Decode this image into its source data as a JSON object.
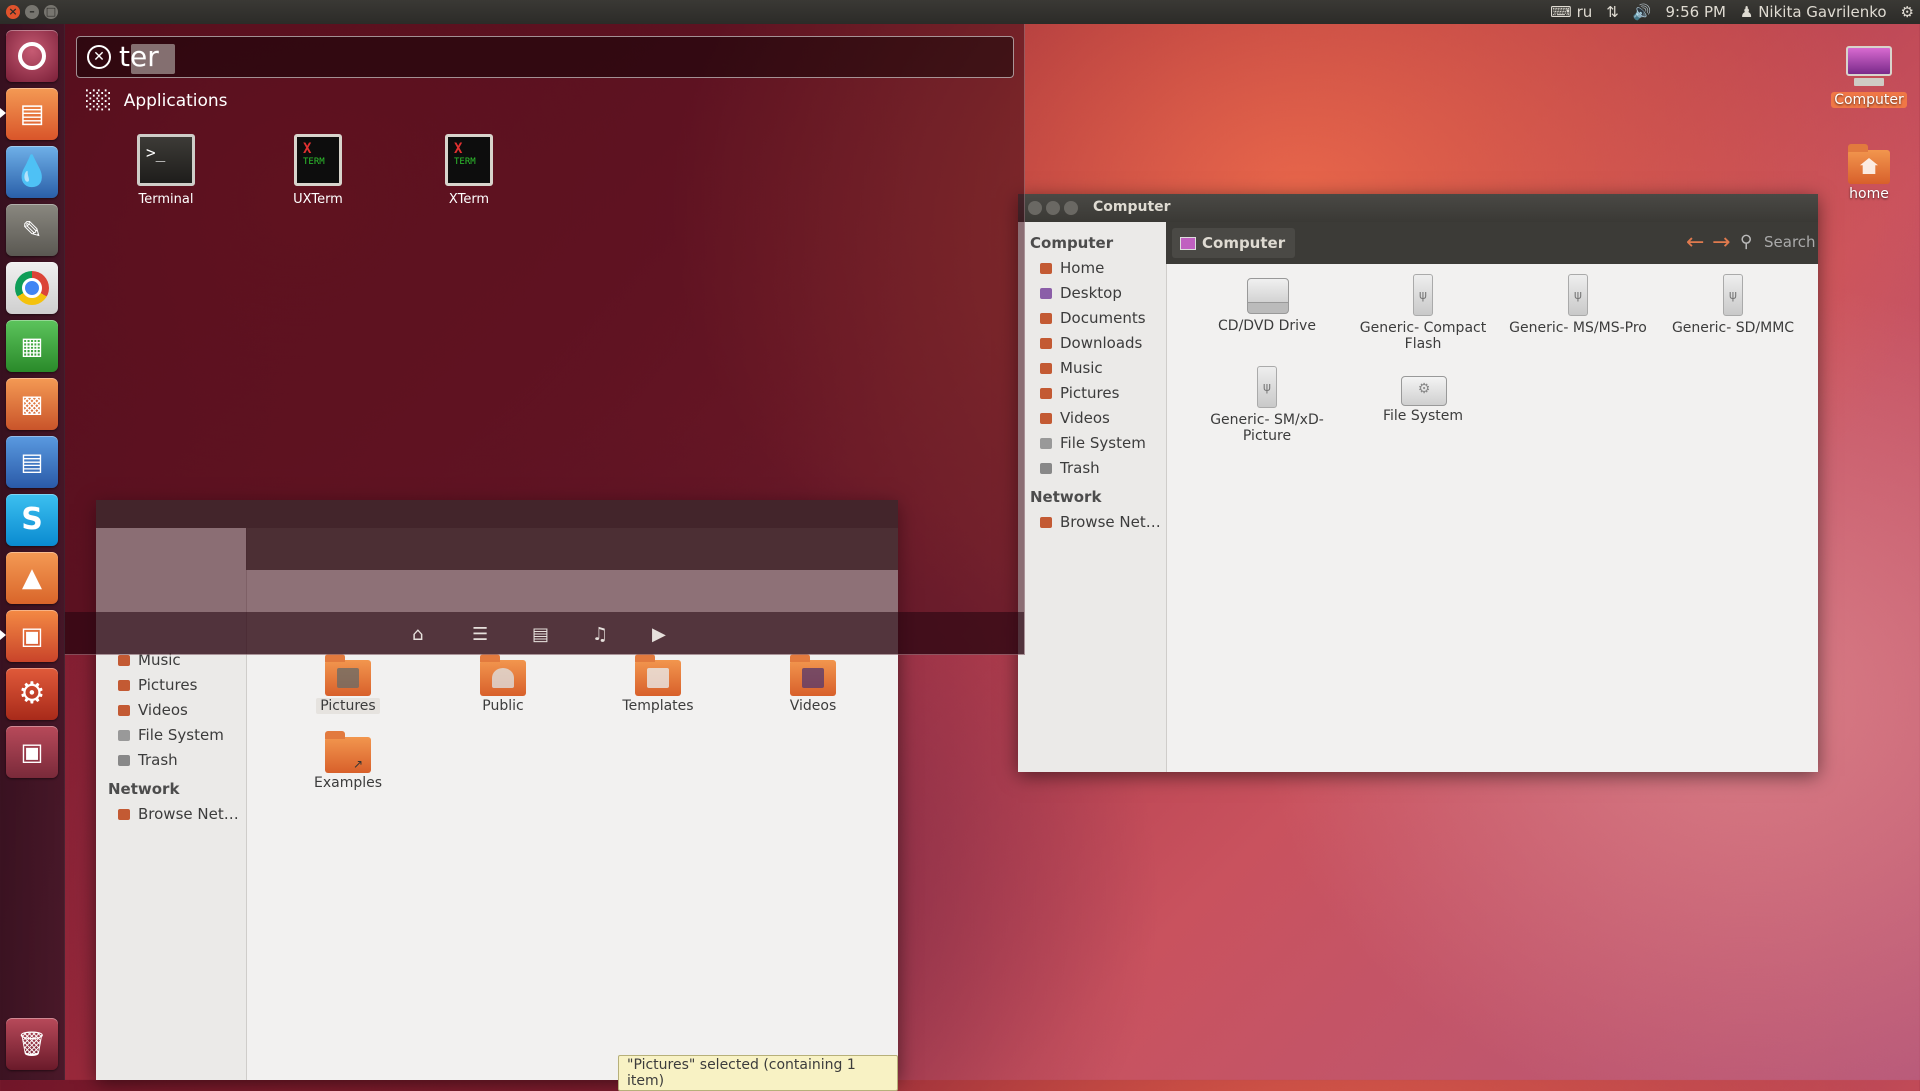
{
  "top_panel": {
    "keyboard_layout": "ru",
    "time": "9:56 PM",
    "user_name": "Nikita Gavrilenko",
    "icons": [
      "keyboard-icon",
      "network-icon",
      "volume-icon",
      "user-icon",
      "gear-icon"
    ]
  },
  "launcher": {
    "items": [
      {
        "name": "dash-home",
        "icon": "ubuntu-logo-icon"
      },
      {
        "name": "files",
        "icon": "folder-icon"
      },
      {
        "name": "drop",
        "icon": "water-drop-icon"
      },
      {
        "name": "gimp",
        "icon": "gimp-icon"
      },
      {
        "name": "chrome",
        "icon": "chrome-icon"
      },
      {
        "name": "calc",
        "icon": "spreadsheet-icon"
      },
      {
        "name": "impress",
        "icon": "presentation-icon"
      },
      {
        "name": "writer",
        "icon": "document-icon"
      },
      {
        "name": "skype",
        "icon": "skype-icon"
      },
      {
        "name": "vlc",
        "icon": "vlc-icon"
      },
      {
        "name": "software-center",
        "icon": "shopping-bag-icon"
      },
      {
        "name": "settings",
        "icon": "settings-icon"
      },
      {
        "name": "workspaces",
        "icon": "workspace-icon"
      },
      {
        "name": "trash",
        "icon": "trash-icon"
      }
    ]
  },
  "dash": {
    "search_query": "ter",
    "category": "Applications",
    "results": [
      {
        "label": "Terminal",
        "icon": "terminal-icon"
      },
      {
        "label": "UXTerm",
        "icon": "xterm-icon"
      },
      {
        "label": "XTerm",
        "icon": "xterm-icon"
      }
    ],
    "lenses": [
      "home-icon",
      "applications-icon",
      "files-icon",
      "music-icon",
      "video-icon"
    ]
  },
  "home_window": {
    "sidebar": {
      "items": [
        {
          "label": "Music"
        },
        {
          "label": "Pictures"
        },
        {
          "label": "Videos"
        },
        {
          "label": "File System"
        },
        {
          "label": "Trash"
        }
      ],
      "network_header": "Network",
      "network_items": [
        {
          "label": "Browse Net…"
        }
      ]
    },
    "items": [
      {
        "label": "Pictures"
      },
      {
        "label": "Public"
      },
      {
        "label": "Templates"
      },
      {
        "label": "Videos"
      },
      {
        "label": "Examples"
      }
    ],
    "status": "\"Pictures\" selected (containing 1 item)"
  },
  "computer_window": {
    "title": "Computer",
    "location": "Computer",
    "search_label": "Search",
    "sidebar": {
      "header": "Computer",
      "items": [
        {
          "label": "Home"
        },
        {
          "label": "Desktop"
        },
        {
          "label": "Documents"
        },
        {
          "label": "Downloads"
        },
        {
          "label": "Music"
        },
        {
          "label": "Pictures"
        },
        {
          "label": "Videos"
        },
        {
          "label": "File System"
        },
        {
          "label": "Trash"
        }
      ],
      "network_header": "Network",
      "network_items": [
        {
          "label": "Browse Net…"
        }
      ]
    },
    "items": [
      {
        "label": "CD/DVD Drive"
      },
      {
        "label": "Generic- Compact Flash"
      },
      {
        "label": "Generic- MS/MS-Pro"
      },
      {
        "label": "Generic- SD/MMC"
      },
      {
        "label": "Generic- SM/xD-Picture"
      },
      {
        "label": "File System"
      }
    ]
  },
  "desktop": {
    "icons": [
      {
        "label": "Computer"
      },
      {
        "label": "home"
      }
    ]
  },
  "colors": {
    "accent": "#dd4814",
    "panel": "#3c3b37",
    "selection": "#f07746"
  }
}
